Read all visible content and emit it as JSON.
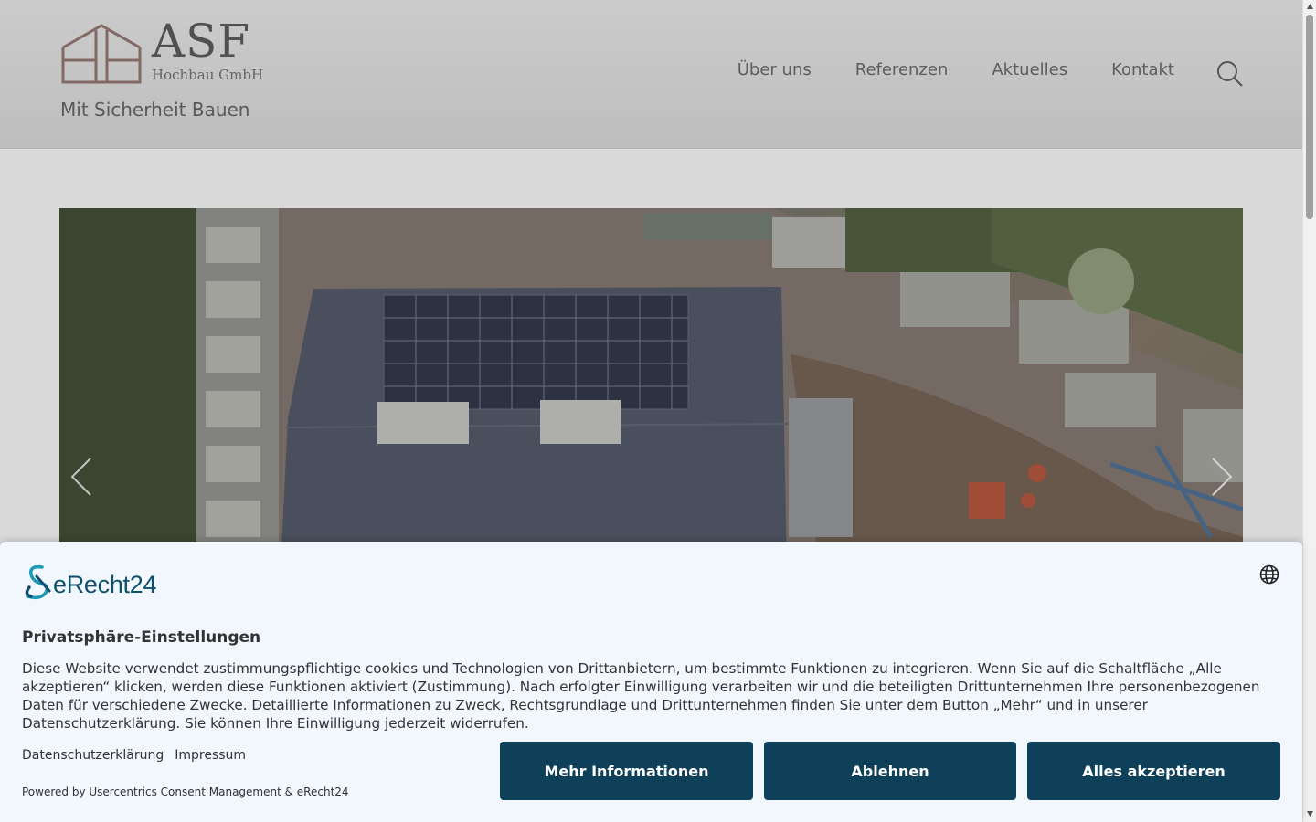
{
  "header": {
    "logo_word": "ASF",
    "logo_sub": "Hochbau GmbH",
    "tagline": "Mit Sicherheit Bauen",
    "nav": [
      "Über uns",
      "Referenzen",
      "Aktuelles",
      "Kontakt"
    ],
    "search_icon": "search-icon"
  },
  "slider": {
    "prev_icon": "chevron-left-icon",
    "next_icon": "chevron-right-icon"
  },
  "consent": {
    "brand": "eRecht24",
    "language_icon": "globe-icon",
    "title": "Privatsphäre-Einstellungen",
    "text": "Diese Website verwendet zustimmungspflichtige cookies und Technologien von Drittanbietern, um bestimmte Funktionen zu integrieren. Wenn Sie auf die Schaltfläche „Alle akzeptieren“ klicken, werden diese Funktionen aktiviert (Zustimmung). Nach erfolgter Einwilligung verarbeiten wir und die beteiligten Drittunternehmen Ihre personenbezogenen Daten für verschiedene Zwecke. Detaillierte Informationen zu Zweck, Rechtsgrundlage und Drittunternehmen finden Sie unter dem Button „Mehr“ und in unserer Datenschutzerklärung. Sie können Ihre Einwilligung jederzeit widerrufen.",
    "links": [
      "Datenschutzerklärung",
      "Impressum"
    ],
    "powered_by": "Powered by Usercentrics Consent Management & eRecht24",
    "buttons": {
      "more": "Mehr Informationen",
      "deny": "Ablehnen",
      "accept": "Alles akzeptieren"
    },
    "button_color": "#0e4159",
    "background_color": "#f1f7fd"
  }
}
